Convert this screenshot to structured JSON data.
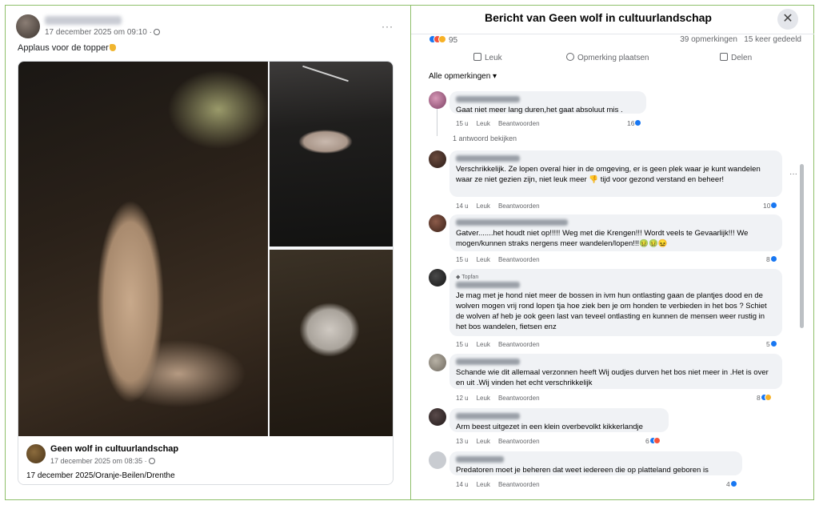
{
  "post": {
    "time": "17 december 2025 om 09:10 ·",
    "text": "Applaus voor de topper",
    "menu": "···",
    "shared": {
      "name": "Geen wolf in cultuurlandschap",
      "time": "17 december 2025 om 08:35 ·",
      "caption": "17 december 2025/Oranje-Beilen/Drenthe"
    }
  },
  "modal": {
    "title": "Bericht van Geen wolf in cultuurlandschap",
    "close": "✕",
    "reactions_count": "95",
    "comments_count": "39 opmerkingen",
    "shares_count": "15 keer gedeeld",
    "actions": {
      "like": "Leuk",
      "comment": "Opmerking plaatsen",
      "share": "Delen"
    },
    "filter": "Alle opmerkingen ▾",
    "view_replies": "1 antwoord bekijken",
    "meta_like": "Leuk",
    "meta_reply": "Beantwoorden",
    "topfan": "Topfan"
  },
  "comments": [
    {
      "text": "Gaat niet meer lang duren,het gaat absoluut mis .",
      "age": "15 u",
      "likes": "16"
    },
    {
      "text": "Verschrikkelijk. Ze lopen overal hier in de omgeving, er is geen plek waar je kunt wandelen waar ze niet gezien zijn, niet leuk meer 👎 tijd voor gezond verstand en beheer!",
      "age": "14 u",
      "likes": "10"
    },
    {
      "text": "Gatver.......het houdt niet op!!!!! Weg met die Krengen!!! Wordt veels te Gevaarlijk!!! We mogen/kunnen straks nergens meer wandelen/lopen!!!🤢🤢😖",
      "age": "15 u",
      "likes": "8"
    },
    {
      "text": "Je mag met je hond niet meer de bossen in ivm hun ontlasting gaan de plantjes dood en de wolven mogen vrij rond lopen tja hoe ziek ben je om honden te verbieden in het bos ? Schiet de wolven af heb je ook geen last van teveel ontlasting en kunnen de mensen weer rustig in het bos wandelen, fietsen enz",
      "age": "15 u",
      "likes": "5"
    },
    {
      "text": "Schande wie dit allemaal verzonnen heeft Wij oudjes durven het bos niet meer in .Het is over en uit .Wij vinden het echt verschrikkelijk",
      "age": "12 u",
      "likes": "8"
    },
    {
      "text": "Arm beest uitgezet in een klein overbevolkt kikkerlandje",
      "age": "13 u",
      "likes": "6"
    },
    {
      "text": "Predatoren moet je beheren dat weet iedereen die op platteland geboren is",
      "age": "14 u",
      "likes": "4"
    }
  ],
  "colors": {
    "accent": "#1877f2",
    "frame": "#8fbf6a",
    "bubble": "#f0f2f5"
  }
}
